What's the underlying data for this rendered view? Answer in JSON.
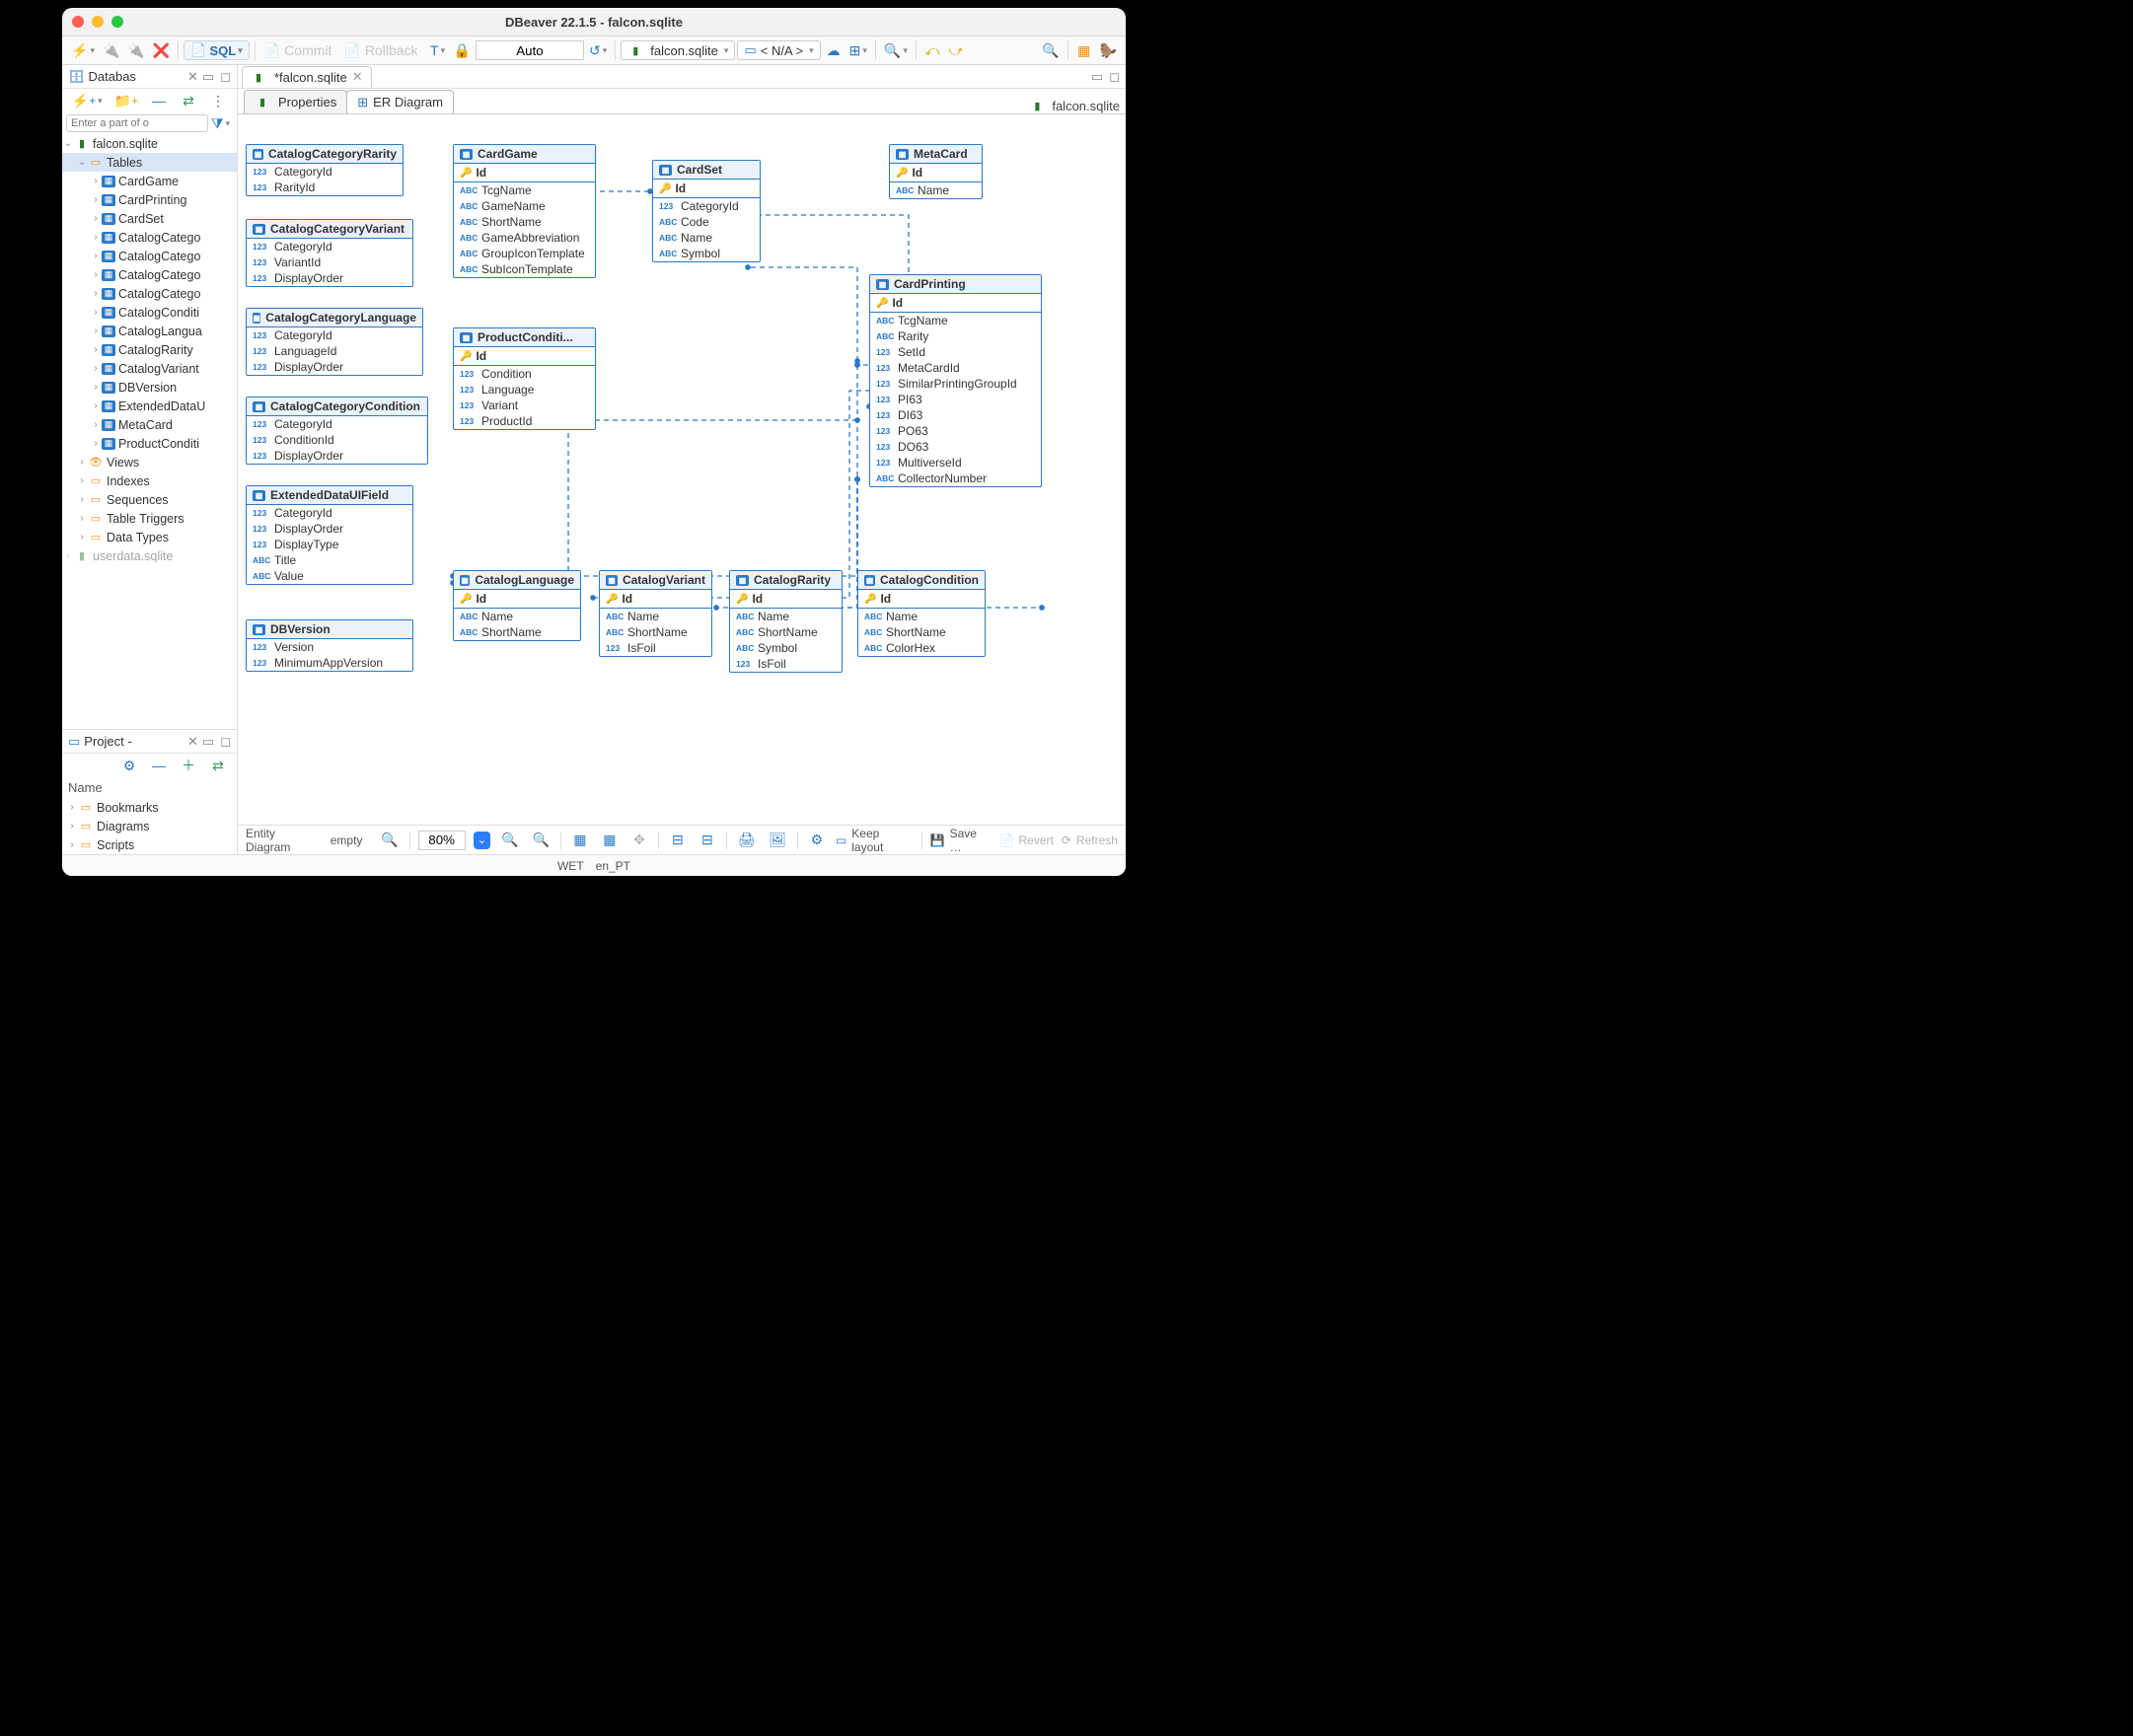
{
  "window": {
    "title": "DBeaver 22.1.5 - falcon.sqlite"
  },
  "toolbar": {
    "sql_label": "SQL",
    "commit_label": "Commit",
    "rollback_label": "Rollback",
    "auto_label": "Auto",
    "db_chip": "falcon.sqlite",
    "na_chip": "< N/A >"
  },
  "nav_panel": {
    "title": "Databas",
    "filter_placeholder": "Enter a part of o",
    "root": "falcon.sqlite",
    "tables_label": "Tables",
    "tables": [
      "CardGame",
      "CardPrinting",
      "CardSet",
      "CatalogCatego",
      "CatalogCatego",
      "CatalogCatego",
      "CatalogCatego",
      "CatalogConditi",
      "CatalogLangua",
      "CatalogRarity",
      "CatalogVariant",
      "DBVersion",
      "ExtendedDataU",
      "MetaCard",
      "ProductConditi"
    ],
    "folders": [
      {
        "label": "Views",
        "icon": "view"
      },
      {
        "label": "Indexes",
        "icon": "fold"
      },
      {
        "label": "Sequences",
        "icon": "fold"
      },
      {
        "label": "Table Triggers",
        "icon": "fold"
      },
      {
        "label": "Data Types",
        "icon": "fold"
      }
    ],
    "other_db": "userdata.sqlite"
  },
  "project_panel": {
    "title": "Project -",
    "name_header": "Name",
    "items": [
      "Bookmarks",
      "Diagrams",
      "Scripts"
    ]
  },
  "editor": {
    "tab_label": "*falcon.sqlite",
    "subtab_properties": "Properties",
    "subtab_er": "ER Diagram",
    "db_label": "falcon.sqlite"
  },
  "entities": {
    "CatalogCategoryRarity": {
      "title": "CatalogCategoryRarity",
      "cols": [
        {
          "t": "123",
          "n": "CategoryId"
        },
        {
          "t": "123",
          "n": "RarityId"
        }
      ]
    },
    "CatalogCategoryVariant": {
      "title": "CatalogCategoryVariant",
      "cols": [
        {
          "t": "123",
          "n": "CategoryId"
        },
        {
          "t": "123",
          "n": "VariantId"
        },
        {
          "t": "123",
          "n": "DisplayOrder"
        }
      ]
    },
    "CatalogCategoryLanguage": {
      "title": "CatalogCategoryLanguage",
      "cols": [
        {
          "t": "123",
          "n": "CategoryId"
        },
        {
          "t": "123",
          "n": "LanguageId"
        },
        {
          "t": "123",
          "n": "DisplayOrder"
        }
      ]
    },
    "CatalogCategoryCondition": {
      "title": "CatalogCategoryCondition",
      "cols": [
        {
          "t": "123",
          "n": "CategoryId"
        },
        {
          "t": "123",
          "n": "ConditionId"
        },
        {
          "t": "123",
          "n": "DisplayOrder"
        }
      ]
    },
    "ExtendedDataUIField": {
      "title": "ExtendedDataUIField",
      "cols": [
        {
          "t": "123",
          "n": "CategoryId"
        },
        {
          "t": "123",
          "n": "DisplayOrder"
        },
        {
          "t": "123",
          "n": "DisplayType"
        },
        {
          "t": "ABC",
          "n": "Title"
        },
        {
          "t": "ABC",
          "n": "Value"
        }
      ]
    },
    "DBVersion": {
      "title": "DBVersion",
      "cols": [
        {
          "t": "123",
          "n": "Version"
        },
        {
          "t": "123",
          "n": "MinimumAppVersion"
        }
      ]
    },
    "CardGame": {
      "title": "CardGame",
      "id": "Id",
      "cols": [
        {
          "t": "ABC",
          "n": "TcgName"
        },
        {
          "t": "ABC",
          "n": "GameName"
        },
        {
          "t": "ABC",
          "n": "ShortName"
        },
        {
          "t": "ABC",
          "n": "GameAbbreviation"
        },
        {
          "t": "ABC",
          "n": "GroupIconTemplate"
        },
        {
          "t": "ABC",
          "n": "SubIconTemplate"
        }
      ]
    },
    "ProductConditi": {
      "title": "ProductConditi...",
      "id": "Id",
      "cols": [
        {
          "t": "123",
          "n": "Condition"
        },
        {
          "t": "123",
          "n": "Language"
        },
        {
          "t": "123",
          "n": "Variant"
        },
        {
          "t": "123",
          "n": "ProductId"
        }
      ]
    },
    "CardSet": {
      "title": "CardSet",
      "id": "Id",
      "cols": [
        {
          "t": "123",
          "n": "CategoryId"
        },
        {
          "t": "ABC",
          "n": "Code"
        },
        {
          "t": "ABC",
          "n": "Name"
        },
        {
          "t": "ABC",
          "n": "Symbol"
        }
      ]
    },
    "MetaCard": {
      "title": "MetaCard",
      "id": "Id",
      "cols": [
        {
          "t": "ABC",
          "n": "Name"
        }
      ]
    },
    "CardPrinting": {
      "title": "CardPrinting",
      "id": "Id",
      "cols": [
        {
          "t": "ABC",
          "n": "TcgName"
        },
        {
          "t": "ABC",
          "n": "Rarity"
        },
        {
          "t": "123",
          "n": "SetId"
        },
        {
          "t": "123",
          "n": "MetaCardId"
        },
        {
          "t": "123",
          "n": "SimilarPrintingGroupId"
        },
        {
          "t": "123",
          "n": "PI63"
        },
        {
          "t": "123",
          "n": "DI63"
        },
        {
          "t": "123",
          "n": "PO63"
        },
        {
          "t": "123",
          "n": "DO63"
        },
        {
          "t": "123",
          "n": "MultiverseId"
        },
        {
          "t": "ABC",
          "n": "CollectorNumber"
        }
      ]
    },
    "CatalogLanguage": {
      "title": "CatalogLanguage",
      "id": "Id",
      "cols": [
        {
          "t": "ABC",
          "n": "Name"
        },
        {
          "t": "ABC",
          "n": "ShortName"
        }
      ]
    },
    "CatalogVariant": {
      "title": "CatalogVariant",
      "id": "Id",
      "cols": [
        {
          "t": "ABC",
          "n": "Name"
        },
        {
          "t": "ABC",
          "n": "ShortName"
        },
        {
          "t": "123",
          "n": "IsFoil"
        }
      ]
    },
    "CatalogRarity": {
      "title": "CatalogRarity",
      "id": "Id",
      "cols": [
        {
          "t": "ABC",
          "n": "Name"
        },
        {
          "t": "ABC",
          "n": "ShortName"
        },
        {
          "t": "ABC",
          "n": "Symbol"
        },
        {
          "t": "123",
          "n": "IsFoil"
        }
      ]
    },
    "CatalogCondition": {
      "title": "CatalogCondition",
      "id": "Id",
      "cols": [
        {
          "t": "ABC",
          "n": "Name"
        },
        {
          "t": "ABC",
          "n": "ShortName"
        },
        {
          "t": "ABC",
          "n": "ColorHex"
        }
      ]
    }
  },
  "footer": {
    "entity_diagram": "Entity Diagram",
    "empty": "empty",
    "zoom": "80%",
    "keep_layout": "Keep layout",
    "save": "Save …",
    "revert": "Revert",
    "refresh": "Refresh"
  },
  "status": {
    "wet": "WET",
    "locale": "en_PT"
  }
}
